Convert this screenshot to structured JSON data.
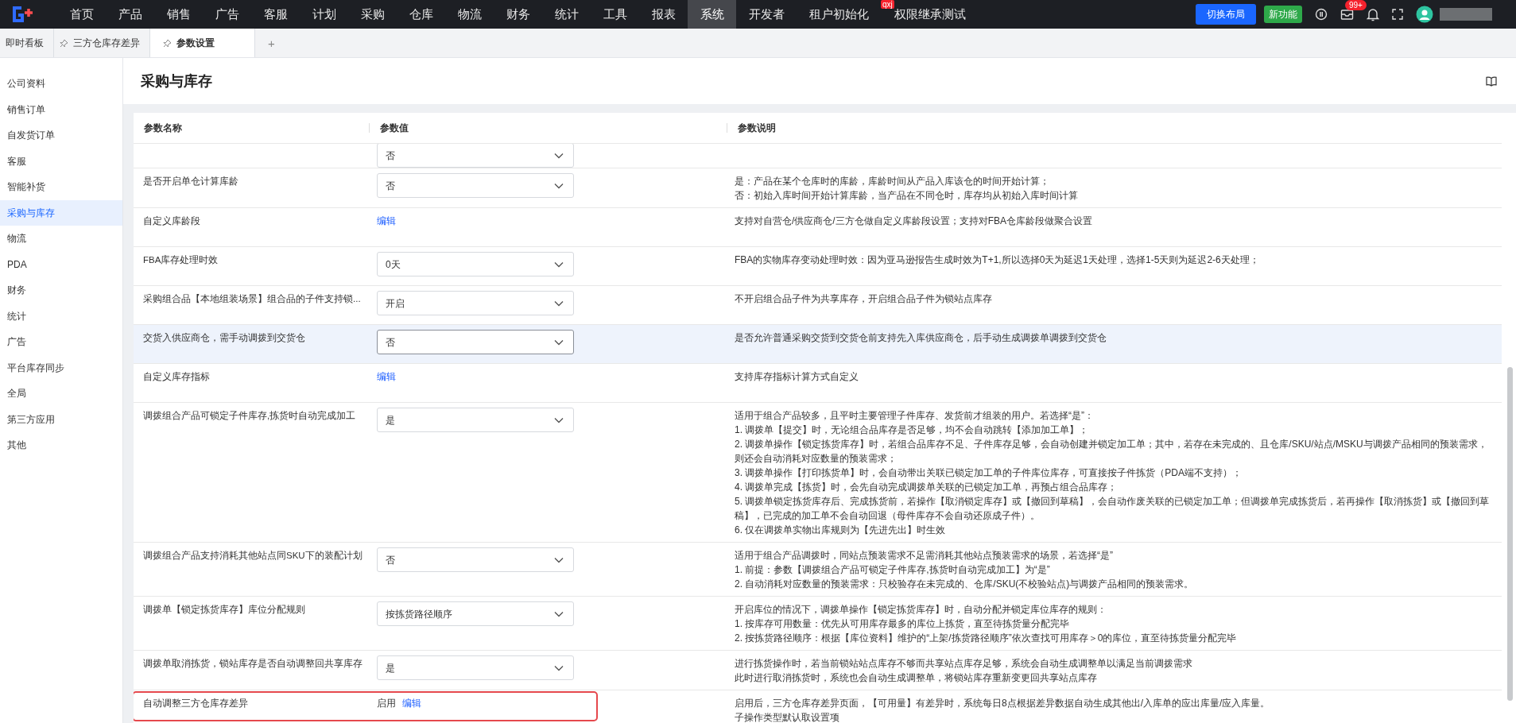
{
  "topbar": {
    "nav": [
      {
        "label": "首页",
        "selected": false
      },
      {
        "label": "产品",
        "selected": false
      },
      {
        "label": "销售",
        "selected": false
      },
      {
        "label": "广告",
        "selected": false
      },
      {
        "label": "客服",
        "selected": false
      },
      {
        "label": "计划",
        "selected": false
      },
      {
        "label": "采购",
        "selected": false
      },
      {
        "label": "仓库",
        "selected": false
      },
      {
        "label": "物流",
        "selected": false
      },
      {
        "label": "财务",
        "selected": false
      },
      {
        "label": "统计",
        "selected": false
      },
      {
        "label": "工具",
        "selected": false
      },
      {
        "label": "报表",
        "selected": false
      },
      {
        "label": "系统",
        "selected": true
      },
      {
        "label": "开发者",
        "selected": false
      },
      {
        "label": "租户初始化",
        "selected": false
      },
      {
        "label": "权限继承测试",
        "selected": false,
        "badge": "qxj"
      }
    ],
    "switch_button": "切换布局",
    "new_feature_button": "新功能",
    "notification_count": "99+"
  },
  "tabs": [
    {
      "label": "即时看板",
      "pinned": false,
      "selected": false
    },
    {
      "label": "三方仓库存差异",
      "pinned": true,
      "selected": false
    },
    {
      "label": "参数设置",
      "pinned": true,
      "selected": true
    }
  ],
  "add_tab": "+",
  "sidebar": {
    "items": [
      {
        "label": "公司资料",
        "selected": false
      },
      {
        "label": "销售订单",
        "selected": false
      },
      {
        "label": "自发货订单",
        "selected": false
      },
      {
        "label": "客服",
        "selected": false
      },
      {
        "label": "智能补货",
        "selected": false
      },
      {
        "label": "采购与库存",
        "selected": true
      },
      {
        "label": "物流",
        "selected": false
      },
      {
        "label": "PDA",
        "selected": false
      },
      {
        "label": "财务",
        "selected": false
      },
      {
        "label": "统计",
        "selected": false
      },
      {
        "label": "广告",
        "selected": false
      },
      {
        "label": "平台库存同步",
        "selected": false
      },
      {
        "label": "全局",
        "selected": false
      },
      {
        "label": "第三方应用",
        "selected": false
      },
      {
        "label": "其他",
        "selected": false
      }
    ]
  },
  "page": {
    "title": "采购与库存"
  },
  "table": {
    "columns": [
      "参数名称",
      "参数值",
      "参数说明"
    ],
    "rows": [
      {
        "kind": "select",
        "value": "否",
        "hovered": false,
        "highlighted": false,
        "partial": true
      },
      {
        "name": "是否开启单仓计算库龄",
        "kind": "select",
        "value": "否",
        "hovered": false,
        "highlighted": false,
        "description": [
          "是：产品在某个仓库时的库龄，库龄时间从产品入库该仓的时间开始计算；",
          "否：初始入库时间开始计算库龄，当产品在不同仓时，库存均从初始入库时间计算"
        ]
      },
      {
        "name": "自定义库龄段",
        "kind": "link",
        "link_label": "编辑",
        "hovered": false,
        "highlighted": false,
        "description": [
          "支持对自营仓/供应商仓/三方仓做自定义库龄段设置；支持对FBA仓库龄段做聚合设置"
        ]
      },
      {
        "name": "FBA库存处理时效",
        "kind": "select",
        "value": "0天",
        "hovered": false,
        "highlighted": false,
        "description": [
          "FBA的实物库存变动处理时效：因为亚马逊报告生成时效为T+1,所以选择0天为延迟1天处理，选择1-5天则为延迟2-6天处理；"
        ]
      },
      {
        "name": "采购组合品【本地组装场景】组合品的子件支持锁...",
        "kind": "select",
        "value": "开启",
        "hovered": false,
        "highlighted": false,
        "description": [
          "不开启组合品子件为共享库存，开启组合品子件为锁站点库存"
        ]
      },
      {
        "name": "交货入供应商仓，需手动调拨到交货仓",
        "kind": "select",
        "value": "否",
        "hovered": true,
        "highlighted": false,
        "description": [
          "是否允许普通采购交货到交货仓前支持先入库供应商仓，后手动生成调拨单调拨到交货仓"
        ]
      },
      {
        "name": "自定义库存指标",
        "kind": "link",
        "link_label": "编辑",
        "hovered": false,
        "highlighted": false,
        "description": [
          "支持库存指标计算方式自定义"
        ]
      },
      {
        "name": "调拨组合产品可锁定子件库存,拣货时自动完成加工",
        "kind": "select",
        "value": "是",
        "hovered": false,
        "highlighted": false,
        "description": [
          "适用于组合产品较多，且平时主要管理子件库存、发货前才组装的用户。若选择“是”：",
          "1. 调拨单【提交】时，无论组合品库存是否足够，均不会自动跳转【添加加工单】；",
          "2. 调拨单操作【锁定拣货库存】时，若组合品库存不足、子件库存足够，会自动创建并锁定加工单；其中，若存在未完成的、且仓库/SKU/站点/MSKU与调拨产品相同的预装需求，则还会自动消耗对应数量的预装需求；",
          "3. 调拨单操作【打印拣货单】时，会自动带出关联已锁定加工单的子件库位库存，可直接按子件拣货（PDA端不支持）；",
          "4. 调拨单完成【拣货】时，会先自动完成调拨单关联的已锁定加工单，再预占组合品库存；",
          "5. 调拨单锁定拣货库存后、完成拣货前，若操作【取消锁定库存】或【撤回到草稿】，会自动作废关联的已锁定加工单；但调拨单完成拣货后，若再操作【取消拣货】或【撤回到草稿】，已完成的加工单不会自动回退（母件库存不会自动还原成子件）。",
          "6. 仅在调拨单实物出库规则为【先进先出】时生效"
        ]
      },
      {
        "name": "调拨组合产品支持消耗其他站点同SKU下的装配计划",
        "kind": "select",
        "value": "否",
        "hovered": false,
        "highlighted": false,
        "description": [
          "适用于组合产品调拨时，同站点预装需求不足需消耗其他站点预装需求的场景，若选择“是”",
          "1. 前提：参数【调拨组合产品可锁定子件库存,拣货时自动完成加工】为“是”",
          "2. 自动消耗对应数量的预装需求：只校验存在未完成的、仓库/SKU(不校验站点)与调拨产品相同的预装需求。"
        ]
      },
      {
        "name": "调拨单【锁定拣货库存】库位分配规则",
        "kind": "select",
        "value": "按拣货路径顺序",
        "hovered": false,
        "highlighted": false,
        "description": [
          "开启库位的情况下，调拨单操作【锁定拣货库存】时，自动分配并锁定库位库存的规则：",
          "1. 按库存可用数量：优先从可用库存最多的库位上拣货，直至待拣货量分配完毕",
          "2. 按拣货路径顺序：根据【库位资料】维护的“上架/拣货路径顺序”依次查找可用库存＞0的库位，直至待拣货量分配完毕"
        ]
      },
      {
        "name": "调拨单取消拣货，锁站库存是否自动调整回共享库存",
        "kind": "select",
        "value": "是",
        "hovered": false,
        "highlighted": false,
        "description": [
          "进行拣货操作时，若当前锁站站点库存不够而共享站点库存足够，系统会自动生成调整单以满足当前调拨需求",
          "此时进行取消拣货时，系统也会自动生成调整单，将锁站库存重新变更回共享站点库存"
        ]
      },
      {
        "name": "自动调整三方仓库存差异",
        "kind": "status_link",
        "status": "启用",
        "edit_label": "编辑",
        "hovered": false,
        "highlighted": true,
        "description": [
          "启用后，三方仓库存差异页面，【可用量】有差异时，系统每日8点根据差异数据自动生成其他出/入库单的应出库量/应入库量。",
          "子操作类型默认取设置项"
        ]
      }
    ]
  }
}
